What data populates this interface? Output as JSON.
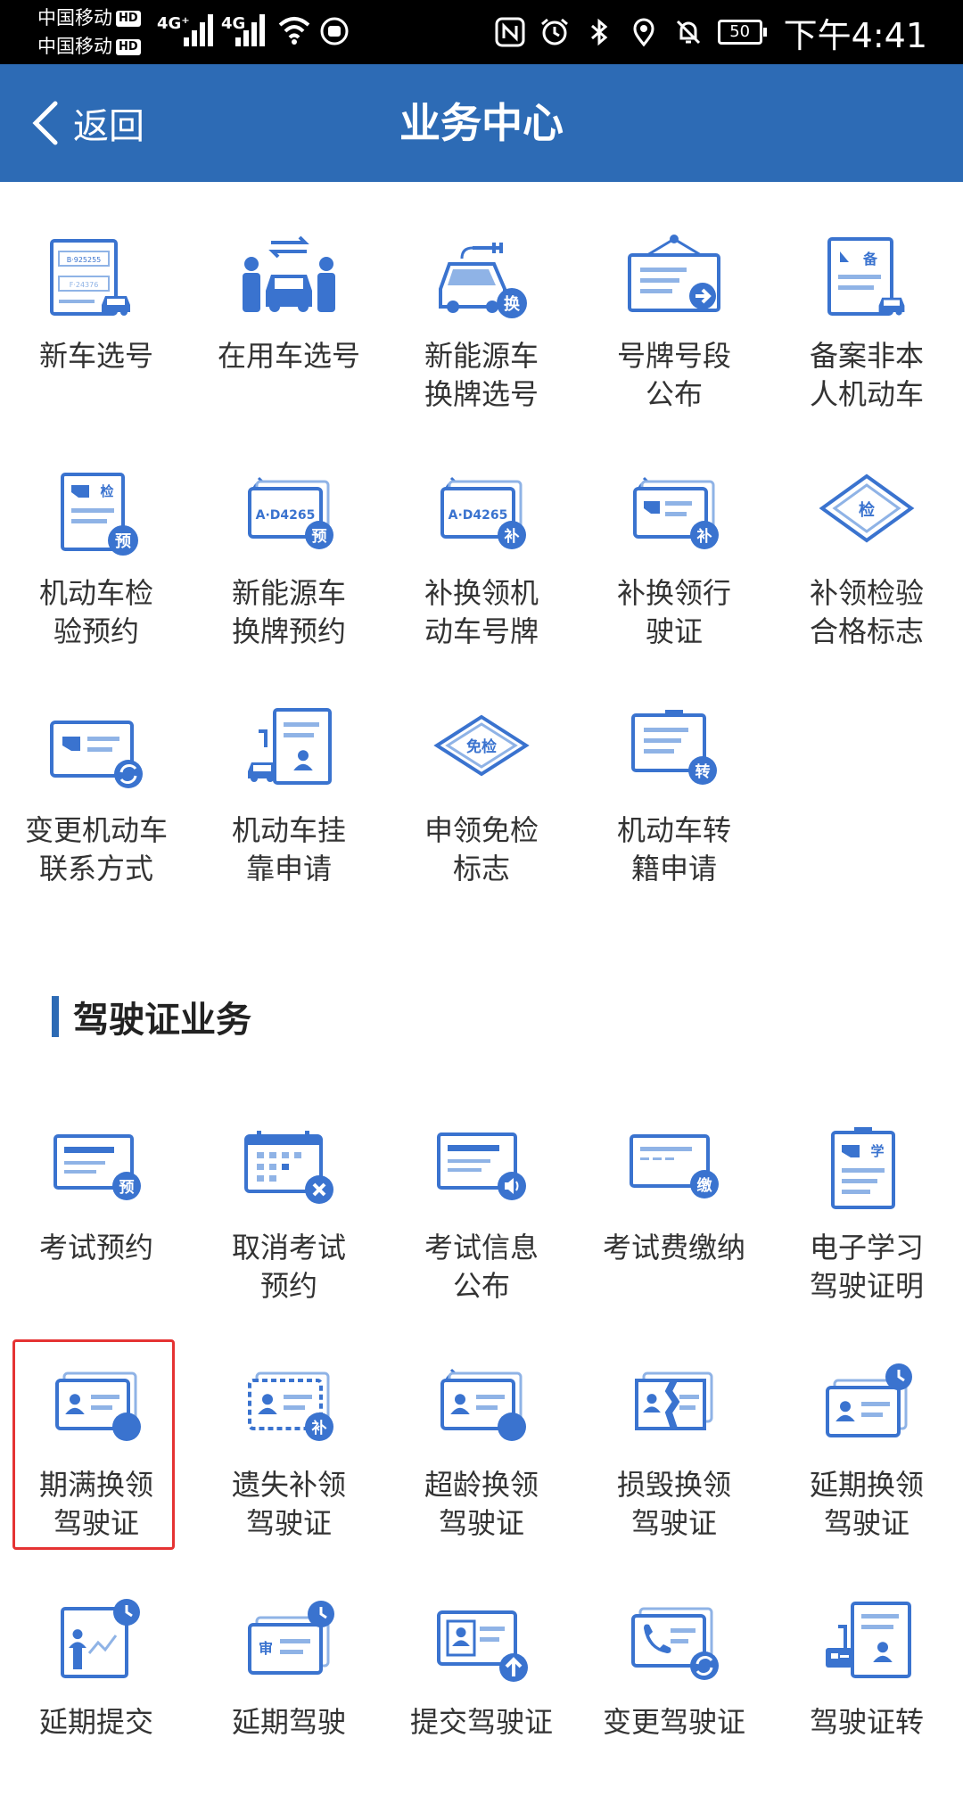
{
  "status_bar": {
    "carrier_1": "中国移动",
    "carrier_2": "中国移动",
    "hd": "HD",
    "net_1": "4G⁺",
    "net_2": "4G",
    "battery": "50",
    "time": "下午4:41"
  },
  "header": {
    "back_label": "返回",
    "title": "业务中心"
  },
  "vehicle_items": [
    {
      "label": "新车选号",
      "icon": "new-car-plate-icon"
    },
    {
      "label": "在用车选号",
      "icon": "car-swap-icon"
    },
    {
      "label": "新能源车\n换牌选号",
      "icon": "ev-car-icon"
    },
    {
      "label": "号牌号段\n公布",
      "icon": "notice-board-icon"
    },
    {
      "label": "备案非本\n人机动车",
      "icon": "record-car-icon"
    },
    {
      "label": "机动车检\n验预约",
      "icon": "inspection-doc-icon"
    },
    {
      "label": "新能源车\n换牌预约",
      "icon": "plate-reserve-icon"
    },
    {
      "label": "补换领机\n动车号牌",
      "icon": "plate-replace-icon"
    },
    {
      "label": "补换领行\n驶证",
      "icon": "license-replace-icon"
    },
    {
      "label": "补领检验\n合格标志",
      "icon": "inspection-sticker-icon"
    },
    {
      "label": "变更机动车\n联系方式",
      "icon": "contact-change-icon"
    },
    {
      "label": "机动车挂\n靠申请",
      "icon": "affiliation-icon"
    },
    {
      "label": "申领免检\n标志",
      "icon": "exempt-sticker-icon"
    },
    {
      "label": "机动车转\n籍申请",
      "icon": "transfer-icon"
    }
  ],
  "plate_texts": {
    "b": "B·925255",
    "f": "F·24376",
    "a": "A·D4265"
  },
  "badge_texts": {
    "huan": "换",
    "yu": "预",
    "bu": "补",
    "jian": "检",
    "bei": "备",
    "mianjian": "免检",
    "zhuan": "转",
    "jiao": "缴",
    "xue": "学",
    "shen": "审"
  },
  "section": {
    "title": "驾驶证业务"
  },
  "license_items": [
    {
      "label": "考试预约",
      "icon": "exam-reserve-icon"
    },
    {
      "label": "取消考试\n预约",
      "icon": "cancel-exam-icon"
    },
    {
      "label": "考试信息\n公布",
      "icon": "exam-info-icon"
    },
    {
      "label": "考试费缴纳",
      "icon": "exam-fee-icon"
    },
    {
      "label": "电子学习\n驾驶证明",
      "icon": "learner-permit-icon"
    },
    {
      "label": "期满换领\n驾驶证",
      "icon": "expiry-renew-icon"
    },
    {
      "label": "遗失补领\n驾驶证",
      "icon": "lost-replace-icon"
    },
    {
      "label": "超龄换领\n驾驶证",
      "icon": "overage-renew-icon"
    },
    {
      "label": "损毁换领\n驾驶证",
      "icon": "damaged-renew-icon"
    },
    {
      "label": "延期换领\n驾驶证",
      "icon": "deferred-renew-icon"
    },
    {
      "label": "延期提交",
      "icon": "deferred-submit-icon"
    },
    {
      "label": "延期驾驶",
      "icon": "deferred-review-icon"
    },
    {
      "label": "提交驾驶证",
      "icon": "submit-license-icon"
    },
    {
      "label": "变更驾驶证",
      "icon": "change-contact-icon"
    },
    {
      "label": "驾驶证转",
      "icon": "license-transfer-icon"
    }
  ],
  "colors": {
    "primary": "#2d6bb5",
    "icon_blue": "#3a73cf",
    "highlight": "#e53333"
  }
}
